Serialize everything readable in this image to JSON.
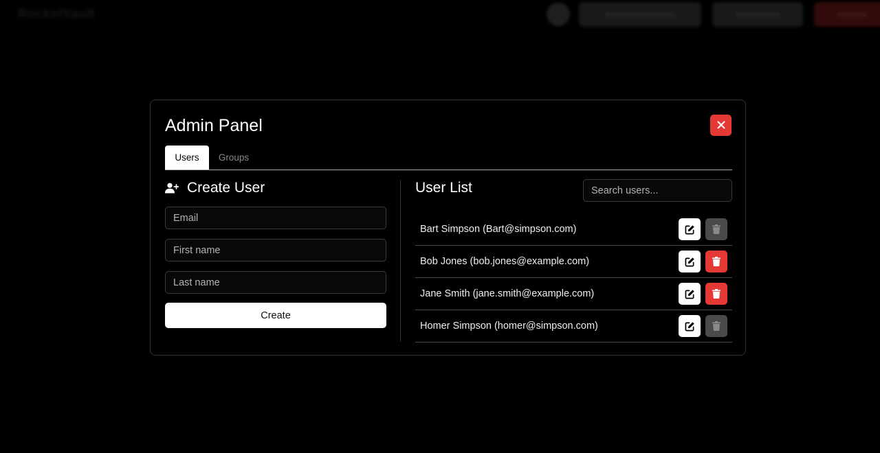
{
  "background": {
    "logo": "RocketVault",
    "buttons": [
      "●●●●●●●●●●●●●●",
      "●●●●●●●●●",
      "●●●●●●"
    ]
  },
  "modal": {
    "title": "Admin Panel",
    "close_icon": "close-icon",
    "tabs": [
      {
        "label": "Users",
        "active": true
      },
      {
        "label": "Groups",
        "active": false
      }
    ]
  },
  "create_user": {
    "heading": "Create User",
    "icon": "user-plus-icon",
    "fields": {
      "email_placeholder": "Email",
      "first_name_placeholder": "First name",
      "last_name_placeholder": "Last name"
    },
    "submit_label": "Create"
  },
  "user_list": {
    "heading": "User List",
    "search_placeholder": "Search users...",
    "users": [
      {
        "label": "Bart Simpson (Bart@simpson.com)",
        "can_delete": false
      },
      {
        "label": "Bob Jones (bob.jones@example.com)",
        "can_delete": true
      },
      {
        "label": "Jane Smith (jane.smith@example.com)",
        "can_delete": true
      },
      {
        "label": "Homer Simpson (homer@simpson.com)",
        "can_delete": false
      }
    ]
  },
  "colors": {
    "danger": "#e53935",
    "disabled": "#4a4a4a",
    "background": "#000000"
  }
}
